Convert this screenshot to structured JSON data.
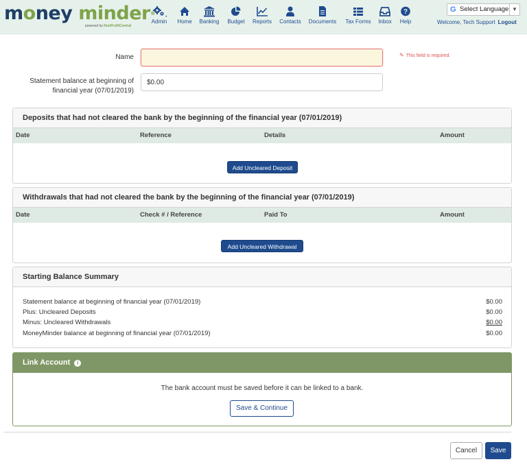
{
  "brand": {
    "logo_part1": "m",
    "logo_o": "o",
    "logo_part2": "ney",
    "logo_part3": "minder",
    "registered": "®",
    "tagline_prefix": "powered by ",
    "tagline_brand": "NonProfitCentral"
  },
  "nav": {
    "items": [
      {
        "label": "Admin",
        "icon": "gears-icon"
      },
      {
        "label": "Home",
        "icon": "home-icon"
      },
      {
        "label": "Banking",
        "icon": "bank-icon"
      },
      {
        "label": "Budget",
        "icon": "pie-chart-icon"
      },
      {
        "label": "Reports",
        "icon": "line-chart-icon"
      },
      {
        "label": "Contacts",
        "icon": "person-icon"
      },
      {
        "label": "Documents",
        "icon": "document-icon"
      },
      {
        "label": "Tax Forms",
        "icon": "tax-forms-icon"
      },
      {
        "label": "Inbox",
        "icon": "inbox-icon"
      },
      {
        "label": "Help",
        "icon": "help-icon"
      }
    ],
    "active_index": 2
  },
  "language": {
    "label": "Select Language",
    "g": "G",
    "caret": "▼"
  },
  "user": {
    "welcome": "Welcome, Tech Support",
    "logout": "Logout"
  },
  "form": {
    "name_label": "Name",
    "name_value": "",
    "name_error": "This field is required.",
    "balance_label_line1": "Statement balance at beginning of",
    "balance_label_line2": "financial year (07/01/2019)",
    "balance_value": "$0.00"
  },
  "deposits": {
    "title": "Deposits that had not cleared the bank by the beginning of the financial year (07/01/2019)",
    "columns": [
      "Date",
      "Reference",
      "Details",
      "Amount"
    ],
    "button": "Add Uncleared Deposit"
  },
  "withdrawals": {
    "title": "Withdrawals that had not cleared the bank by the beginning of the financial year (07/01/2019)",
    "columns": [
      "Date",
      "Check # / Reference",
      "Paid To",
      "Amount"
    ],
    "button": "Add Uncleared Withdrawal"
  },
  "summary": {
    "title": "Starting Balance Summary",
    "rows": [
      {
        "label": "Statement balance at beginning of financial year (07/01/2019)",
        "amount": "$0.00"
      },
      {
        "label": "Plus: Uncleared Deposits",
        "amount": "$0.00"
      },
      {
        "label": "Minus: Uncleared Withdrawals",
        "amount": "$0.00"
      },
      {
        "label": "MoneyMinder balance at beginning of financial year (07/01/2019)",
        "amount": "$0.00"
      }
    ]
  },
  "link_account": {
    "title": "Link Account",
    "info": "i",
    "message": "The bank account must be saved before it can be linked to a bank.",
    "button": "Save & Continue"
  },
  "footer": {
    "cancel": "Cancel",
    "save": "Save"
  },
  "colors": {
    "brand_navy": "#1f4b8e",
    "brand_green": "#7ea34a",
    "link_head": "#7f9766",
    "error": "#d9534f"
  }
}
